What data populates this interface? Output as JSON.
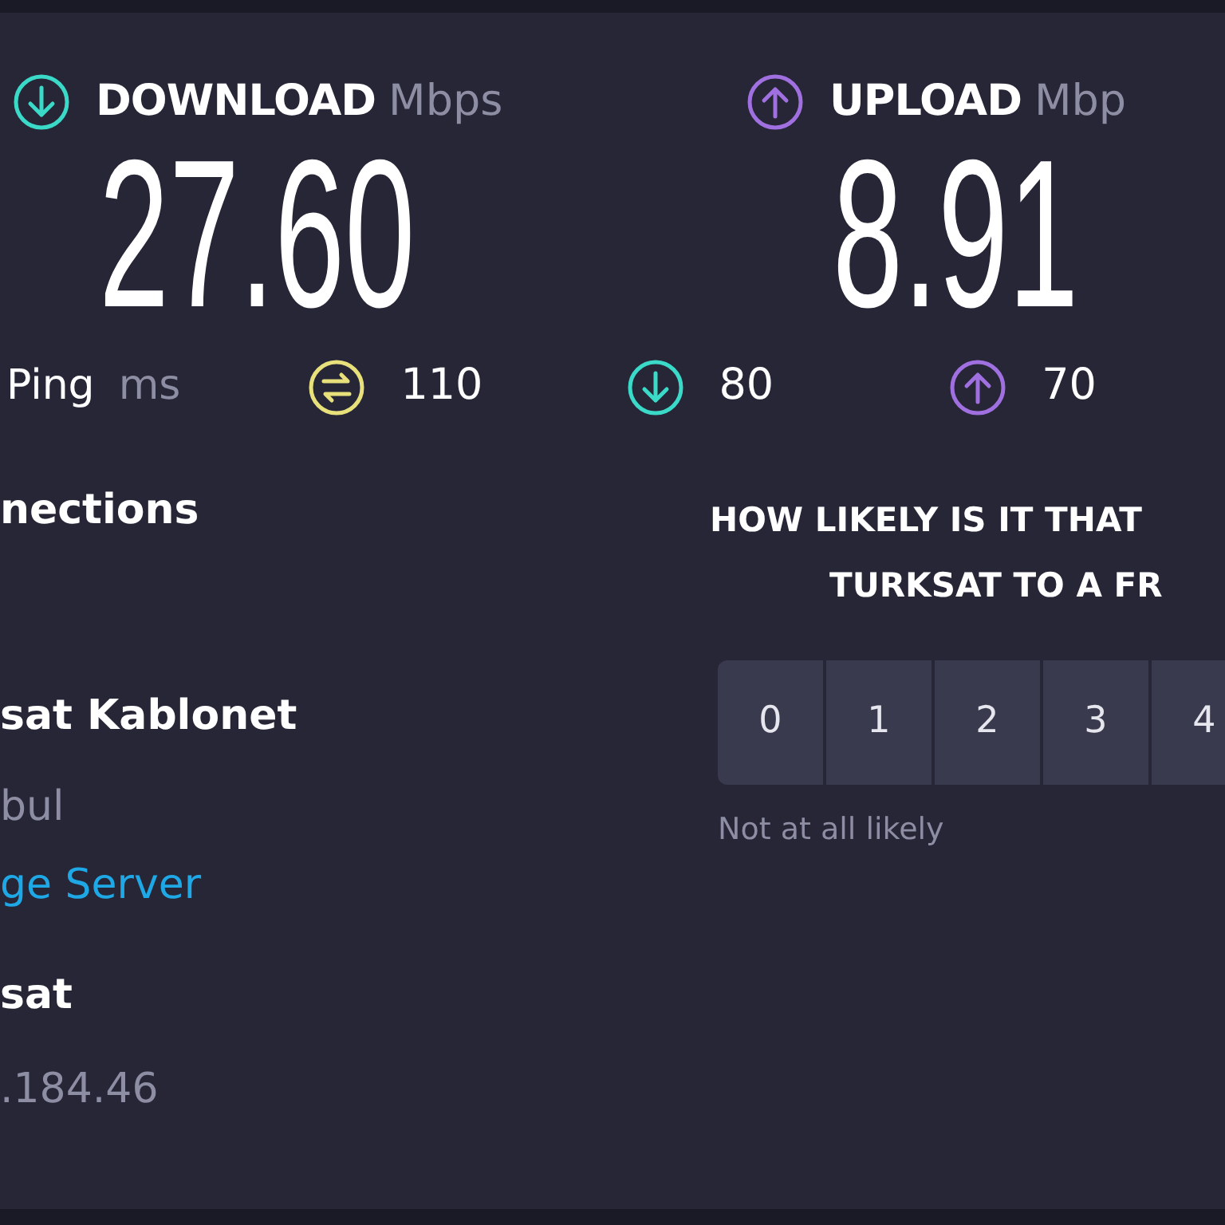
{
  "speeds": [
    {
      "kind": "download",
      "label": "DOWNLOAD",
      "unit": "Mbps",
      "value": "27.60"
    },
    {
      "kind": "upload",
      "label": "UPLOAD",
      "unit": "Mbp",
      "value": "8.91"
    }
  ],
  "ping": {
    "label": "Ping",
    "unit": "ms",
    "readings": [
      {
        "kind": "jitter",
        "value": "110"
      },
      {
        "kind": "download",
        "value": "80"
      },
      {
        "kind": "upload",
        "value": "70"
      }
    ]
  },
  "connection": {
    "heading": "nections",
    "items": [
      {
        "kind": "title",
        "text": "sat Kablonet"
      },
      {
        "kind": "detail",
        "text": "bul"
      },
      {
        "kind": "link",
        "text": "ge Server"
      },
      {
        "kind": "title",
        "text": "sat"
      },
      {
        "kind": "detail",
        "text": ".184.46"
      }
    ]
  },
  "survey": {
    "question_lines": [
      "HOW LIKELY IS IT THAT",
      "TURKSAT TO A FR"
    ],
    "scale": [
      {
        "label": "0",
        "selected": false
      },
      {
        "label": "1",
        "selected": false
      },
      {
        "label": "2",
        "selected": false
      },
      {
        "label": "3",
        "selected": false
      },
      {
        "label": "4",
        "selected": false
      }
    ],
    "low_label": "Not at all likely"
  }
}
